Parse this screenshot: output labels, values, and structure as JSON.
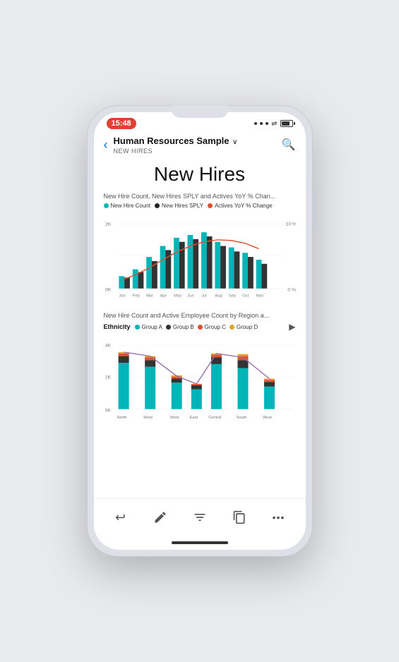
{
  "status": {
    "time": "15:48",
    "dots": [
      "•",
      "•",
      "•"
    ]
  },
  "nav": {
    "back_label": "‹",
    "title": "Human Resources Sample",
    "dropdown_indicator": "∨",
    "subtitle": "NEW HIRES",
    "search_icon": "search"
  },
  "page": {
    "title": "New Hires"
  },
  "chart1": {
    "title": "New Hire Count, New Hires SPLY and Actives YoY % Chan...",
    "legend": [
      {
        "label": "New Hire Count",
        "color": "#00b5b8"
      },
      {
        "label": "New Hires SPLY",
        "color": "#222"
      },
      {
        "label": "Actives YoY % Change",
        "color": "#e05030"
      }
    ],
    "y_left_labels": [
      "2K",
      "0K"
    ],
    "y_right_labels": [
      "10 %",
      "0 %"
    ],
    "x_labels": [
      "Jan",
      "Feb",
      "Mar",
      "Apr",
      "May",
      "Jun",
      "Jul",
      "Aug",
      "Sep",
      "Oct",
      "Nov"
    ],
    "bars_teal": [
      18,
      30,
      50,
      70,
      90,
      95,
      100,
      85,
      75,
      65,
      50
    ],
    "bars_dark": [
      15,
      25,
      45,
      65,
      80,
      88,
      92,
      78,
      68,
      58,
      44
    ],
    "line_points": [
      20,
      30,
      38,
      50,
      62,
      70,
      78,
      82,
      80,
      76,
      68
    ]
  },
  "chart2": {
    "title": "New Hire Count and Active Employee Count by Region a...",
    "ethnicity_label": "Ethnicity",
    "legend": [
      {
        "label": "Group A",
        "color": "#00b5b8"
      },
      {
        "label": "Group B",
        "color": "#333"
      },
      {
        "label": "Group C",
        "color": "#e05030"
      },
      {
        "label": "Group D",
        "color": "#e8a020"
      }
    ],
    "y_labels": [
      "4K",
      "2K",
      "0K"
    ],
    "x_labels": [
      "North",
      "West",
      "West",
      "East",
      "Central",
      "South",
      "West"
    ],
    "stacked_bars": [
      [
        80,
        15,
        5,
        2
      ],
      [
        70,
        20,
        6,
        4
      ],
      [
        40,
        10,
        3,
        2
      ],
      [
        25,
        8,
        3,
        1
      ],
      [
        75,
        18,
        5,
        3
      ],
      [
        65,
        25,
        8,
        5
      ],
      [
        35,
        12,
        4,
        2
      ]
    ],
    "line_points": [
      85,
      90,
      60,
      40,
      82,
      78,
      45
    ]
  },
  "toolbar": {
    "undo_icon": "↩",
    "pen_icon": "✒",
    "filter_icon": "⊽",
    "copy_icon": "⧉",
    "more_icon": "···"
  }
}
